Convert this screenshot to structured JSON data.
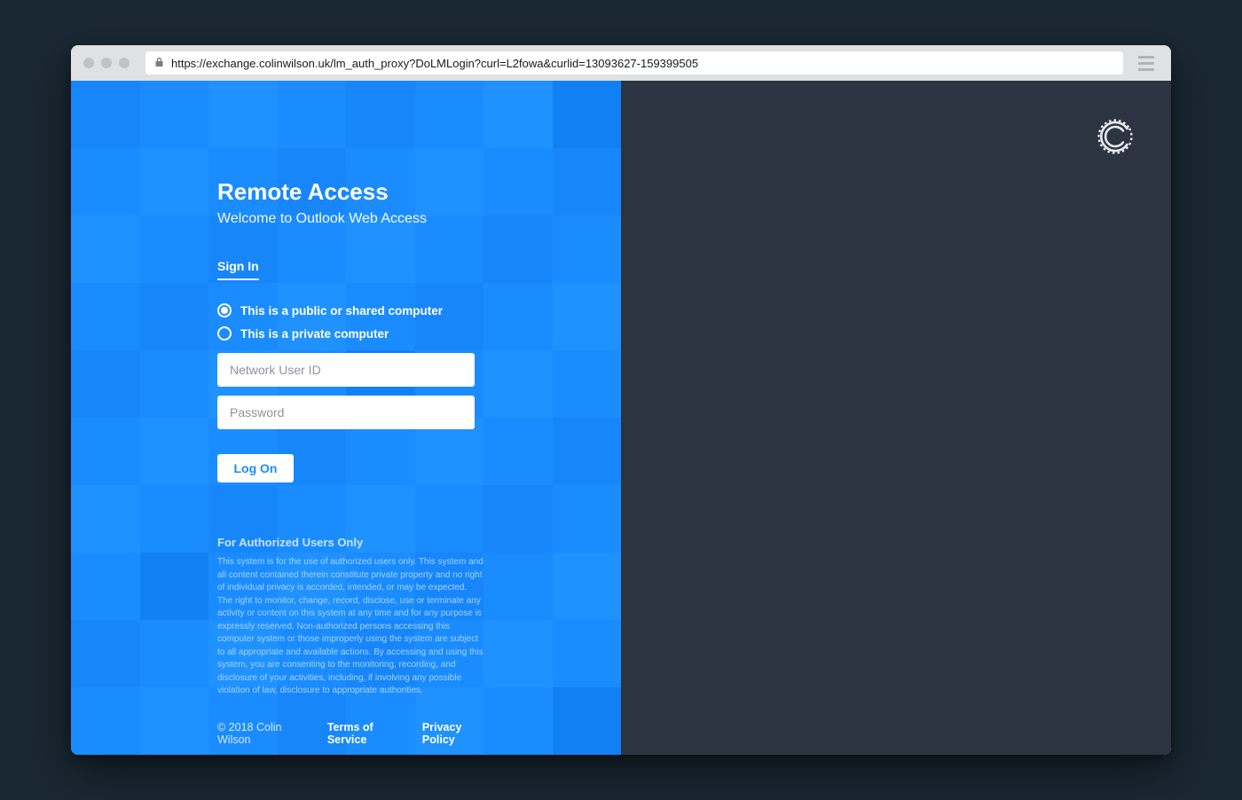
{
  "browser": {
    "url": "https://exchange.colinwilson.uk/lm_auth_proxy?DoLMLogin?curl=L2fowa&curlid=13093627-159399505"
  },
  "page": {
    "title": "Remote Access",
    "subtitle": "Welcome to Outlook Web Access",
    "signin_label": "Sign In",
    "radio_public": "This is a public or shared computer",
    "radio_private": "This is a private computer",
    "userid_placeholder": "Network User ID",
    "password_placeholder": "Password",
    "logon_label": "Log On",
    "auth_title": "For Authorized Users Only",
    "auth_text": "This system is for the use of authorized users only. This system and all content contained therein constitute private property and no right of individual privacy is accorded, intended, or may be expected. The right to monitor, change, record, disclose, use or terminate any activity or content on this system at any time and for any purpose is expressly reserved. Non-authorized persons accessing this computer system or those improperly using the system are subject to all appropriate and available actions. By accessing and using this system, you are consenting to the monitoring, recording, and disclosure of your activities, including, if involving any possible violation of law, disclosure to appropriate authorities.",
    "copyright": "© 2018 Colin Wilson",
    "terms_label": "Terms of Service",
    "privacy_label": "Privacy Policy"
  }
}
